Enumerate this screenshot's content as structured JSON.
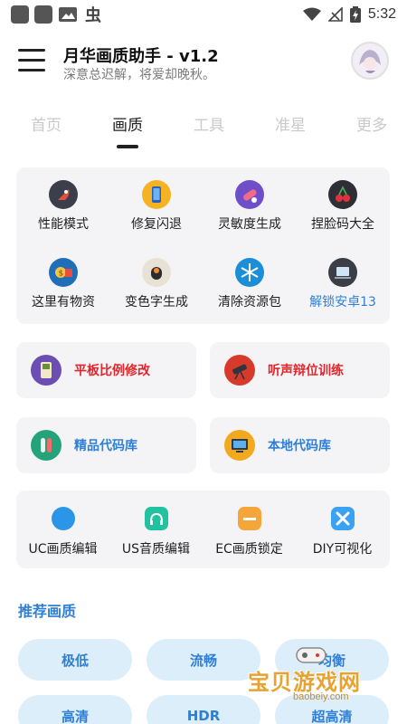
{
  "status_bar": {
    "time": "5:32",
    "notif_glyph": "虫"
  },
  "header": {
    "title": "月华画质助手 - v1.2",
    "subtitle": "深意总迟解，将爱却晚秋。"
  },
  "tabs": [
    {
      "label": "首页"
    },
    {
      "label": "画质"
    },
    {
      "label": "工具"
    },
    {
      "label": "准星"
    },
    {
      "label": "更多"
    }
  ],
  "grid": [
    {
      "label": "性能模式",
      "icon": "rocket-icon",
      "color": "#3a3f4b"
    },
    {
      "label": "修复闪退",
      "icon": "phone-icon",
      "color": "#f5b323"
    },
    {
      "label": "灵敏度生成",
      "icon": "pills-icon",
      "color": "#6f4fc9"
    },
    {
      "label": "捏脸码大全",
      "icon": "cherry-icon",
      "color": "#2e2f36"
    },
    {
      "label": "这里有物资",
      "icon": "money-icon",
      "color": "#1f6fb8"
    },
    {
      "label": "变色字生成",
      "icon": "sushi-icon",
      "color": "#e8e2d6"
    },
    {
      "label": "清除资源包",
      "icon": "snowflake-icon",
      "color": "#1c8ed8"
    },
    {
      "label": "解锁安卓13",
      "icon": "laptop-icon",
      "color": "#3b3e47"
    }
  ],
  "row_cards": [
    {
      "label": "平板比例修改",
      "icon": "gameboy-icon",
      "color": "#6b4db3",
      "text_color": "#e0262c"
    },
    {
      "label": "听声辩位训练",
      "icon": "telescope-icon",
      "color": "#d63a2a",
      "text_color": "#e0262c"
    },
    {
      "label": "精品代码库",
      "icon": "lab-icon",
      "color": "#24a37a",
      "text_color": "#2f7fd6"
    },
    {
      "label": "本地代码库",
      "icon": "computer-icon",
      "color": "#f2a91d",
      "text_color": "#2f7fd6"
    }
  ],
  "tools": [
    {
      "label": "UC画质编辑",
      "icon": "uc-icon",
      "color": "#2b95e8"
    },
    {
      "label": "US音质编辑",
      "icon": "headphone-icon",
      "color": "#20c2a0"
    },
    {
      "label": "EC画质锁定",
      "icon": "doc-icon",
      "color": "#f5a63a"
    },
    {
      "label": "DIY可视化",
      "icon": "diy-icon",
      "color": "#3aa2f0"
    }
  ],
  "section_title": "推荐画质",
  "quality_pills": [
    {
      "label": "极低"
    },
    {
      "label": "流畅"
    },
    {
      "label": "均衡"
    },
    {
      "label": "高清"
    },
    {
      "label": "HDR"
    },
    {
      "label": "超高清"
    }
  ],
  "watermark": {
    "text": "宝贝游戏网",
    "url": "baobeiy.com"
  },
  "colors": {
    "accent": "#2f7fd6",
    "danger": "#e0262c",
    "card_bg": "#f4f4f6",
    "pill_bg": "#ddeefb"
  }
}
